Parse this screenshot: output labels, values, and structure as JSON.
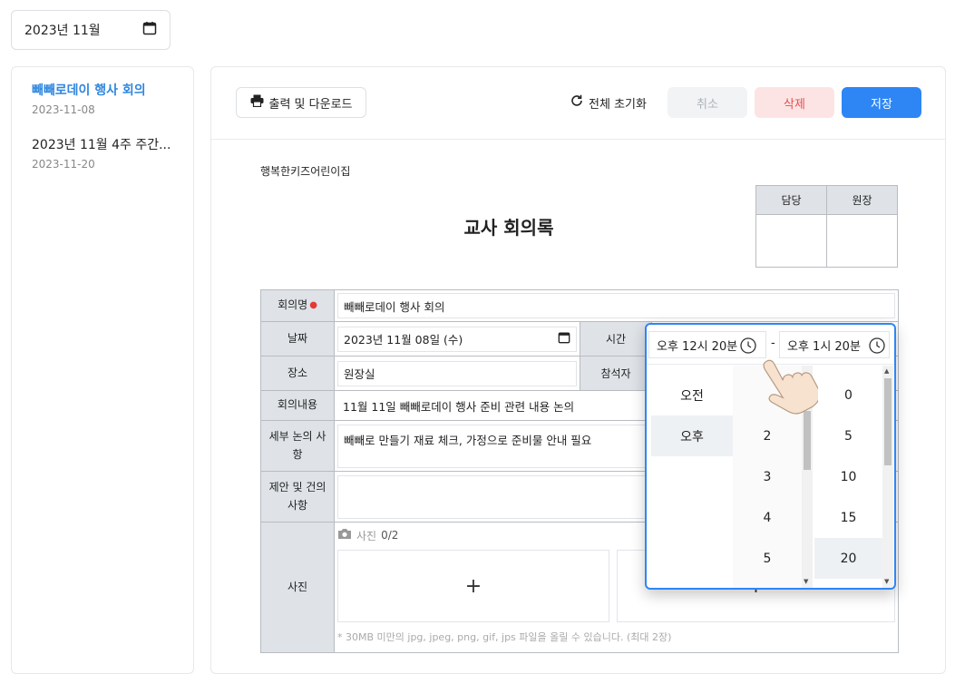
{
  "month_picker": {
    "value": "2023년 11월",
    "icon": "calendar-icon"
  },
  "sidebar": {
    "items": [
      {
        "title": "빼빼로데이 행사 회의",
        "date": "2023-11-08",
        "active": true
      },
      {
        "title": "2023년 11월 4주 주간...",
        "date": "2023-11-20",
        "active": false
      }
    ]
  },
  "toolbar": {
    "print_label": "출력 및 다운로드",
    "reset_label": "전체 초기화",
    "cancel_label": "취소",
    "delete_label": "삭제",
    "save_label": "저장"
  },
  "document": {
    "org": "행복한키즈어린이집",
    "title": "교사 회의록",
    "approval_headers": [
      "담당",
      "원장"
    ]
  },
  "form": {
    "name_label": "회의명",
    "name_value": "빼빼로데이 행사 회의",
    "date_label": "날짜",
    "date_value": "2023년 11월 08일 (수)",
    "time_label": "시간",
    "place_label": "장소",
    "place_value": "원장실",
    "attendee_label": "참석자",
    "content_label": "회의내용",
    "content_value": "11월 11일 빼빼로데이 행사 준비 관련 내용 논의",
    "detail_label": "세부 논의 사항",
    "detail_value": "빼빼로 만들기 재료 체크, 가정으로 준비물 안내 필요",
    "suggest_label": "제안 및 건의 사항",
    "photo_label": "사진",
    "photo_caption": "사진",
    "photo_count": "0/2",
    "photo_add": "+",
    "photo_note": "* 30MB 미만의 jpg, jpeg, png, gif, jps 파일을 올릴 수 있습니다. (최대 2장)"
  },
  "time_picker": {
    "start": "오후 12시 20분",
    "separator": "-",
    "end": "오후 1시 20분",
    "ampm": [
      "오전",
      "오후"
    ],
    "ampm_selected": "오후",
    "hours": [
      "2",
      "3",
      "4",
      "5"
    ],
    "minutes": [
      "0",
      "5",
      "10",
      "15",
      "20"
    ],
    "minutes_selected": "20"
  },
  "colors": {
    "accent": "#2e86f5",
    "danger": "#e35050",
    "label_bg": "#dfe3e8"
  }
}
